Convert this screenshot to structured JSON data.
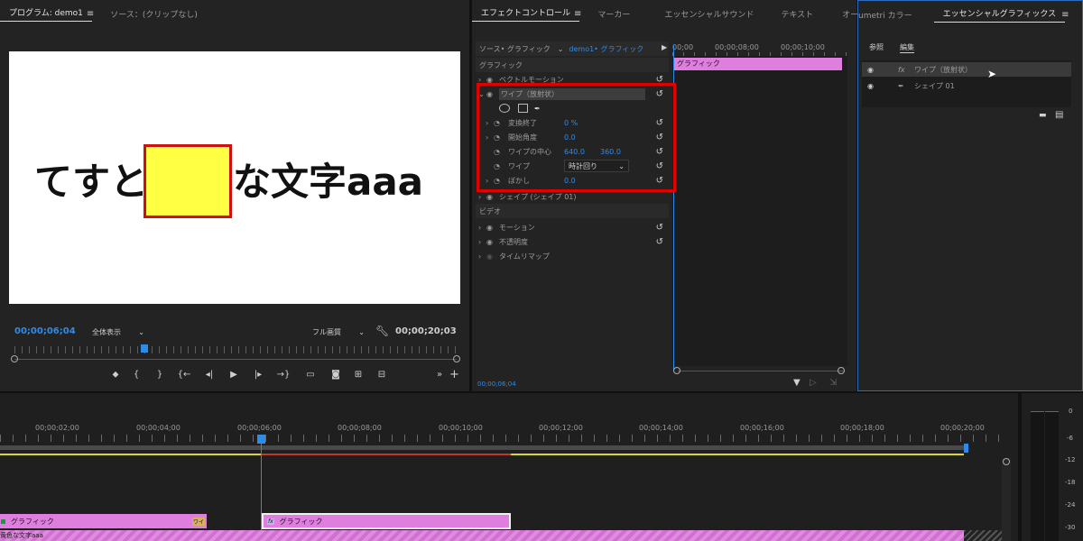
{
  "program_monitor": {
    "tab_program": "プログラム: demo1",
    "tab_source": "ソース：(クリップなし)",
    "preview_text_left": "てすと",
    "preview_text_right": "な文字aaa",
    "timecode_current": "00;00;06;04",
    "zoom_select": "全体表示",
    "quality_select": "フル画質",
    "timecode_total": "00;00;20;03"
  },
  "effect_controls": {
    "tabs": [
      "エフェクトコントロール",
      "マーカー",
      "エッセンシャルサウンド",
      "テキスト",
      "オー"
    ],
    "source_label": "ソース• グラフィック",
    "sequence_label": "demo1• グラフィック",
    "ruler_labels": [
      "00;00",
      "00;00;08;00",
      "00;00;10;00"
    ],
    "clip_label": "グラフィック",
    "section_graphic": "グラフィック",
    "rows": {
      "vector_motion": "ベクトルモーション",
      "wipe_title": "ワイプ（放射状）",
      "transition_end": "変換終了",
      "transition_end_value": "0 %",
      "start_angle": "開始角度",
      "start_angle_value": "0.0",
      "wipe_center": "ワイプの中心",
      "wipe_center_x": "640.0",
      "wipe_center_y": "360.0",
      "wipe": "ワイプ",
      "wipe_value": "時計回り",
      "feather": "ぼかし",
      "feather_value": "0.0",
      "shape": "シェイプ (シェイプ 01)",
      "section_video": "ビデオ",
      "motion": "モーション",
      "opacity": "不透明度",
      "time_remap": "タイムリマップ"
    },
    "footer_timecode": "00;00;06;04"
  },
  "essential_graphics": {
    "tab_lumetri": "umetri カラー",
    "tab_eg": "エッセンシャルグラフィックス",
    "sub_browse": "参照",
    "sub_edit": "編集",
    "layer1": "ワイプ（放射状）",
    "layer2": "シェイプ 01"
  },
  "timeline": {
    "ruler_labels": [
      "00;00;02;00",
      "00;00;04;00",
      "00;00;06;00",
      "00;00;08;00",
      "00;00;10;00",
      "00;00;12;00",
      "00;00;14;00",
      "00;00;16;00",
      "00;00;18;00",
      "00;00;20;00"
    ],
    "clip1_label": "グラフィック",
    "clip1_badge": "ワイ",
    "clip2_label": "グラフィック",
    "clip2_fx": "fx",
    "clip3_label": "黄色な文字aaa"
  },
  "audio_meter": {
    "labels": [
      "0",
      "-6",
      "-12",
      "-18",
      "-24",
      "-30"
    ]
  },
  "colors": {
    "accent_blue": "#2d8ceb",
    "highlight_red": "#e00000",
    "clip_pink": "#e07ee0",
    "yellow_box": "#ffff44"
  }
}
